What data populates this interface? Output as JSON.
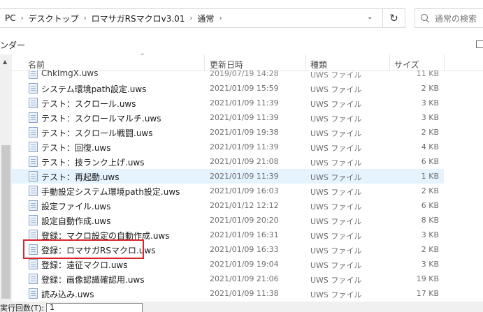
{
  "address_bar": {
    "crumbs": [
      "PC",
      "デスクトップ",
      "ロマサガRSマクロv3.01",
      "通常"
    ],
    "search_placeholder": "通常の検索"
  },
  "toolbar": {
    "label": "ンダー"
  },
  "columns": {
    "name": "名前",
    "date": "更新日時",
    "type": "種類",
    "size": "サイズ"
  },
  "files": [
    {
      "name": "ChkImgX.uws",
      "date": "2019/07/19 14:28",
      "type": "UWS ファイル",
      "size": "11 KB"
    },
    {
      "name": "システム環境path設定.uws",
      "date": "2021/01/09 15:59",
      "type": "UWS ファイル",
      "size": "2 KB"
    },
    {
      "name": "テスト：スクロール.uws",
      "date": "2021/01/09 11:39",
      "type": "UWS ファイル",
      "size": "3 KB"
    },
    {
      "name": "テスト：スクロールマルチ.uws",
      "date": "2021/01/09 11:39",
      "type": "UWS ファイル",
      "size": "3 KB"
    },
    {
      "name": "テスト：スクロール戦闘.uws",
      "date": "2021/01/09 19:38",
      "type": "UWS ファイル",
      "size": "2 KB"
    },
    {
      "name": "テスト：回復.uws",
      "date": "2021/01/09 11:39",
      "type": "UWS ファイル",
      "size": "4 KB"
    },
    {
      "name": "テスト：技ランク上げ.uws",
      "date": "2021/01/09 21:08",
      "type": "UWS ファイル",
      "size": "6 KB"
    },
    {
      "name": "テスト：再起動.uws",
      "date": "2021/01/09 11:39",
      "type": "UWS ファイル",
      "size": "1 KB"
    },
    {
      "name": "手動設定システム環境path設定.uws",
      "date": "2021/01/09 16:03",
      "type": "UWS ファイル",
      "size": "2 KB"
    },
    {
      "name": "設定ファイル.uws",
      "date": "2021/01/12 12:12",
      "type": "UWS ファイル",
      "size": "6 KB"
    },
    {
      "name": "設定自動作成.uws",
      "date": "2021/01/09 20:20",
      "type": "UWS ファイル",
      "size": "8 KB"
    },
    {
      "name": "登録：マクロ設定の自動作成.uws",
      "date": "2021/01/09 16:31",
      "type": "UWS ファイル",
      "size": "3 KB"
    },
    {
      "name": "登録：ロマサガRSマクロ.uws",
      "date": "2021/01/09 16:33",
      "type": "UWS ファイル",
      "size": "2 KB"
    },
    {
      "name": "登録：遠征マクロ.uws",
      "date": "2021/01/09 19:04",
      "type": "UWS ファイル",
      "size": "3 KB"
    },
    {
      "name": "登録：画像認識確認用.uws",
      "date": "2021/01/09 21:06",
      "type": "UWS ファイル",
      "size": "19 KB"
    },
    {
      "name": "読み込み.uws",
      "date": "2021/01/09 11:38",
      "type": "UWS ファイル",
      "size": "17 KB"
    }
  ],
  "status_bar": {
    "label": "実行回数(T):",
    "value": "1"
  }
}
